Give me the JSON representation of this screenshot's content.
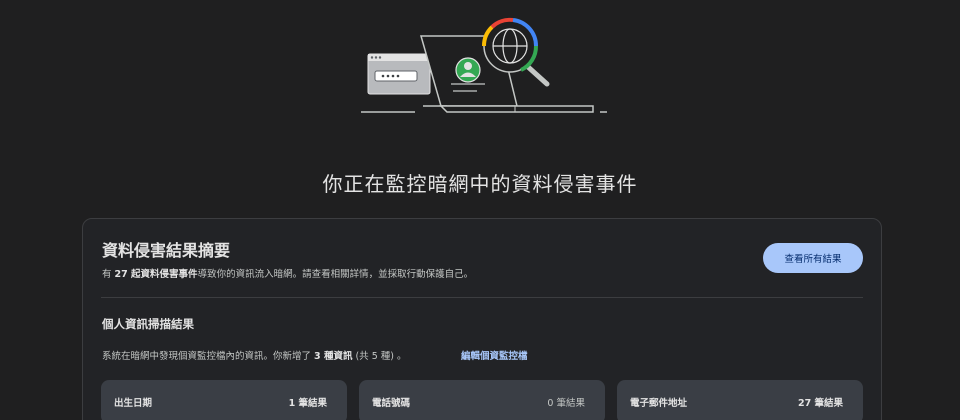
{
  "page": {
    "title": "你正在監控暗網中的資料侵害事件"
  },
  "illustration": {
    "icon": "dark-web-monitor-illustration",
    "colors": [
      "#4285f4",
      "#ea4335",
      "#fbbc04",
      "#34a853"
    ]
  },
  "summary": {
    "title": "資料侵害結果摘要",
    "desc_prefix": "有 ",
    "desc_count": "27 起資料侵害事件",
    "desc_suffix": "導致你的資訊流入暗網。請查看相關詳情，並採取行動保護自己。",
    "view_all_label": "查看所有結果"
  },
  "scan": {
    "title": "個人資訊掃描結果",
    "desc_prefix": "系統在暗網中發現個資監控檔內的資訊。你新增了 ",
    "desc_count": "3 種資訊",
    "desc_suffix": " (共 5 種) 。",
    "edit_link": "編輯個資監控檔"
  },
  "results": [
    {
      "label": "出生日期",
      "count": "1 筆結果"
    },
    {
      "label": "電話號碼",
      "count": "0 筆結果"
    },
    {
      "label": "電子郵件地址",
      "count": "27 筆結果"
    }
  ],
  "colors": {
    "background": "#1f1f20",
    "accent": "#a8c7fa",
    "tile": "#3a3e45"
  }
}
